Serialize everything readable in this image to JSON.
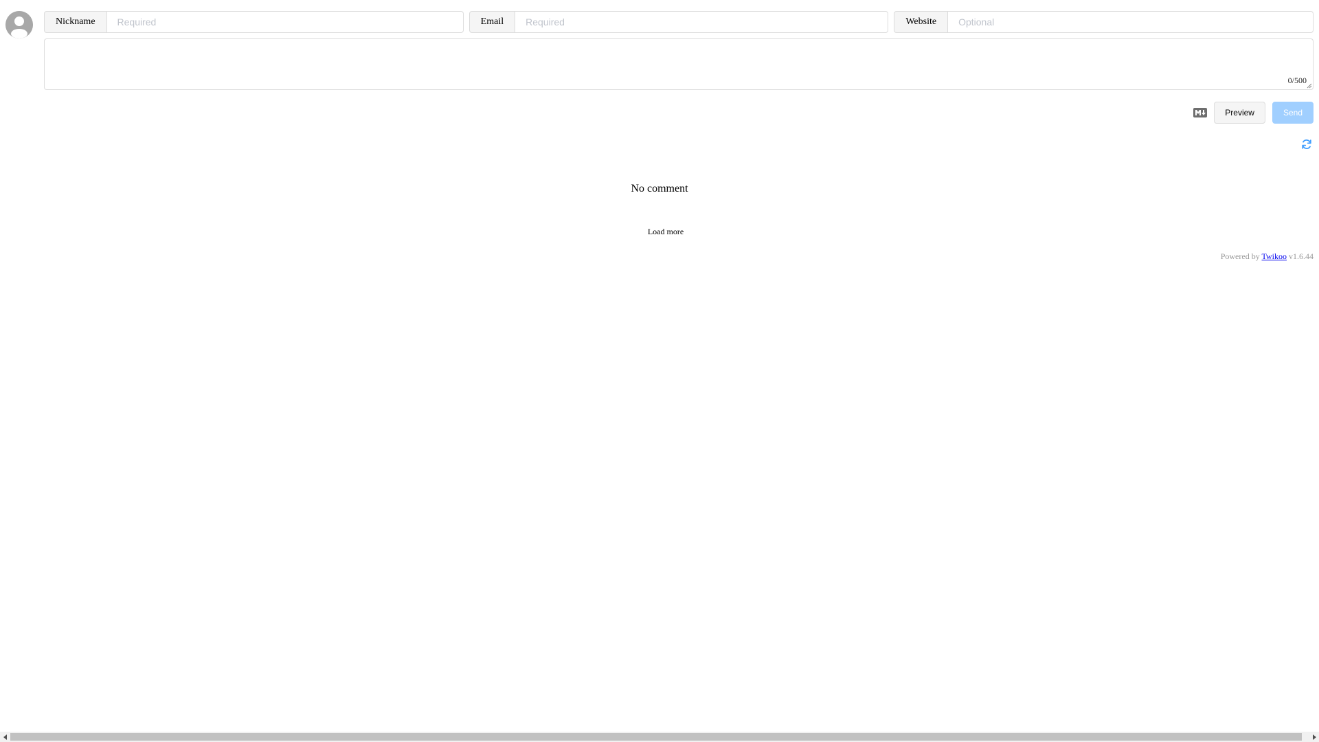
{
  "form": {
    "nickname": {
      "label": "Nickname",
      "value": "",
      "placeholder": "Required"
    },
    "email": {
      "label": "Email",
      "value": "",
      "placeholder": "Required"
    },
    "website": {
      "label": "Website",
      "value": "",
      "placeholder": "Optional"
    },
    "comment": {
      "value": "",
      "placeholder": "",
      "counter": "0/500"
    }
  },
  "actions": {
    "markdown_icon": "markdown-icon",
    "preview_label": "Preview",
    "send_label": "Send"
  },
  "comments": {
    "refresh_icon": "refresh-icon",
    "empty_text": "No comment",
    "load_more_label": "Load more"
  },
  "footer": {
    "powered_prefix": "Powered by",
    "brand_link": "Twikoo",
    "version": "v1.6.44"
  },
  "colors": {
    "accent": "#409eff",
    "send_disabled": "#a0cfff",
    "link": "#0000ee",
    "avatar": "#a8a8a8"
  }
}
